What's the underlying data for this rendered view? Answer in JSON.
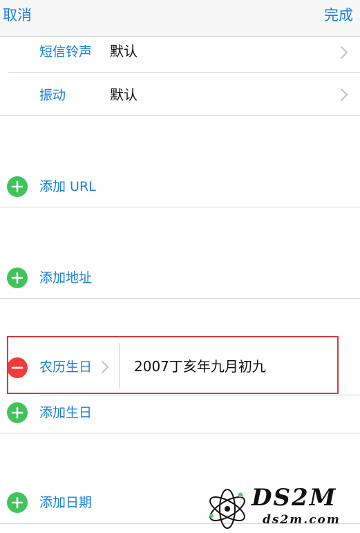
{
  "nav": {
    "cancel_label": "取消",
    "done_label": "完成"
  },
  "rows": {
    "sms_tone_label": "短信铃声",
    "sms_tone_value": "默认",
    "vibration_label": "振动",
    "vibration_value": "默认",
    "add_url_label": "添加 URL",
    "add_address_label": "添加地址",
    "lunar_birthday_label": "农历生日",
    "lunar_birthday_value": "2007丁亥年九月初九",
    "add_birthday_label": "添加生日",
    "add_date_label": "添加日期"
  },
  "watermark": {
    "title": "DS2M",
    "subtitle": "ds2m.com"
  },
  "colors": {
    "accent": "#1a7fe0",
    "add_green": "#3fc35a",
    "delete_red": "#f23a3a",
    "highlight_red": "#d43a3a"
  }
}
